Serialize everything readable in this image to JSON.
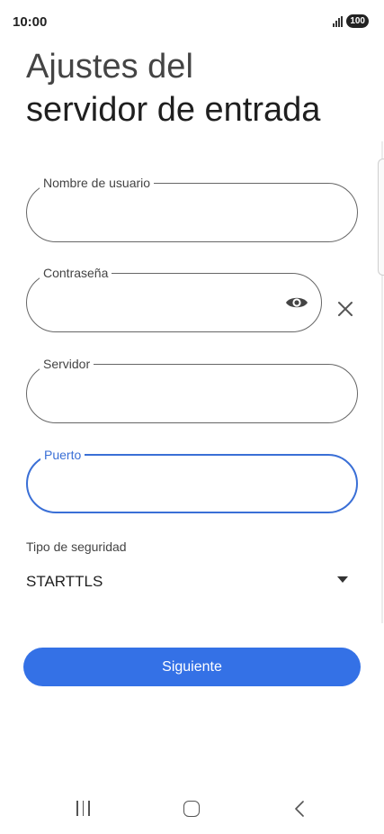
{
  "status_bar": {
    "time": "10:00",
    "battery": "100"
  },
  "page": {
    "title_line1": "Ajustes del",
    "title_line2": "servidor de entrada"
  },
  "fields": {
    "username": {
      "label": "Nombre de usuario",
      "value": ""
    },
    "password": {
      "label": "Contraseña",
      "value": ""
    },
    "server": {
      "label": "Servidor",
      "value": ""
    },
    "port": {
      "label": "Puerto",
      "value": ""
    }
  },
  "security": {
    "label": "Tipo de seguridad",
    "value": "STARTTLS"
  },
  "actions": {
    "next_label": "Siguiente"
  },
  "colors": {
    "accent": "#3471e6",
    "focus_border": "#3a6fd6"
  },
  "icons": {
    "password_toggle": "eye-icon",
    "clear": "close-icon",
    "dropdown": "dropdown-arrow-icon",
    "nav_recent": "recent-apps-icon",
    "nav_home": "home-icon",
    "nav_back": "back-icon"
  }
}
